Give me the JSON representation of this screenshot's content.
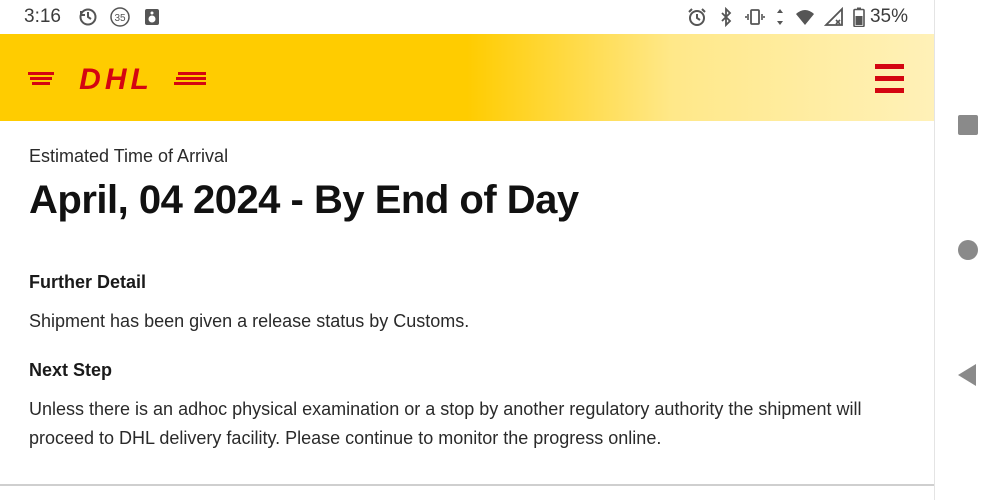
{
  "status_bar": {
    "time": "3:16",
    "notification_badge": "35",
    "battery_percent": "35%",
    "icons": [
      "sync-icon",
      "notification-count-icon",
      "speaker-icon",
      "alarm-icon",
      "bluetooth-icon",
      "vibrate-icon",
      "data-arrows-icon",
      "wifi-icon",
      "signal-icon",
      "battery-icon"
    ]
  },
  "header": {
    "logo_text": "DHL",
    "brand_colors": {
      "yellow": "#ffcc00",
      "red": "#d40511"
    },
    "menu_icon": "hamburger-menu-icon"
  },
  "eta": {
    "label": "Estimated Time of Arrival",
    "value": "April, 04 2024 - By End of Day"
  },
  "further_detail": {
    "title": "Further Detail",
    "text": "Shipment has been given a release status by Customs."
  },
  "next_step": {
    "title": "Next Step",
    "text": "Unless there is an adhoc physical examination or a stop by another regulatory authority the shipment will proceed to DHL delivery facility. Please continue to monitor the progress online."
  },
  "nav_bar": {
    "icons": [
      "recents-square-icon",
      "home-circle-icon",
      "back-triangle-icon"
    ]
  }
}
